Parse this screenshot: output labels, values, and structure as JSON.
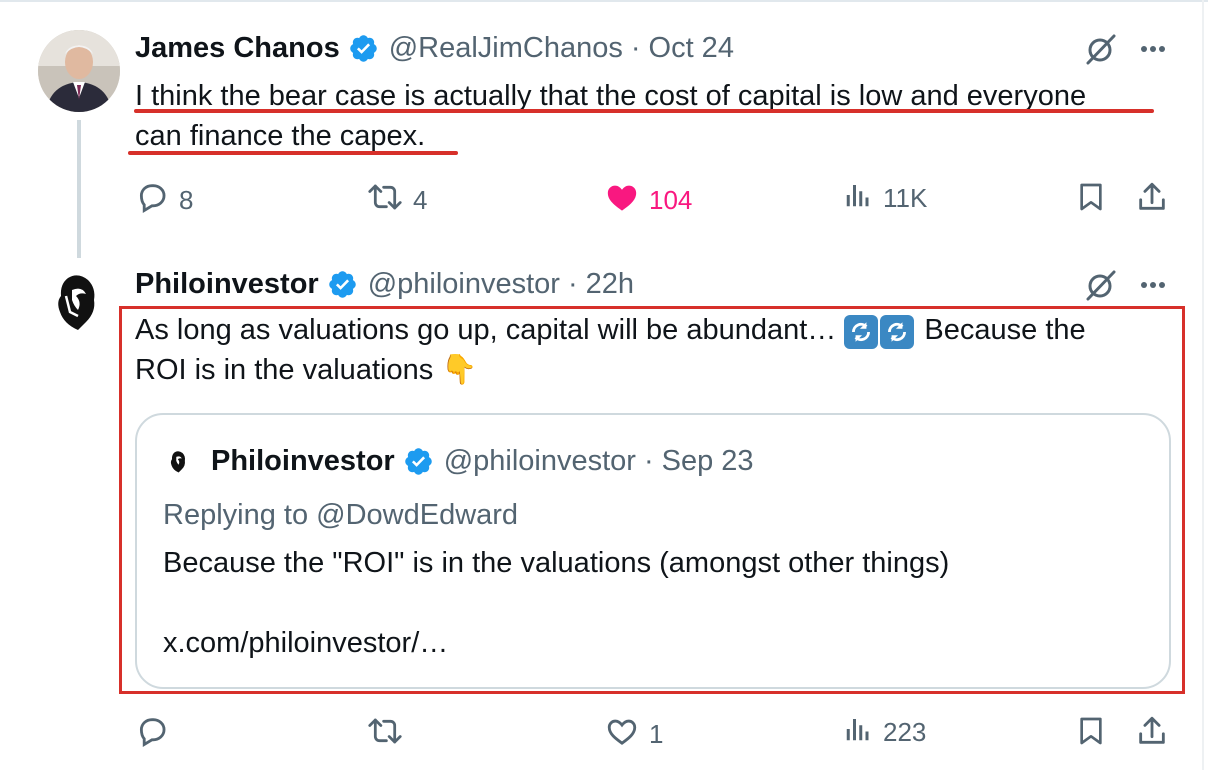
{
  "tweet1": {
    "name": "James Chanos",
    "handle": "@RealJimChanos",
    "separator": "·",
    "time": "Oct 24",
    "text_line1": "I think the bear case is actually that the cost of capital is low and everyone",
    "text_line2": "can finance the capex.",
    "actions": {
      "replies": "8",
      "reposts": "4",
      "likes": "104",
      "views": "11K"
    }
  },
  "tweet2": {
    "name": "Philoinvestor",
    "handle": "@philoinvestor",
    "separator": "·",
    "time": "22h",
    "text_part1": "As long as valuations go up, capital will be abundant…",
    "text_part2": "Because the",
    "text_line2": "ROI is in the valuations",
    "emoji_pointing": "👇",
    "actions": {
      "replies": "",
      "reposts": "",
      "likes": "1",
      "views": "223"
    }
  },
  "quote": {
    "name": "Philoinvestor",
    "handle": "@philoinvestor",
    "separator": "·",
    "time": "Sep 23",
    "replying_to": "Replying to @DowdEdward",
    "text": "Because the \"ROI\" is in the valuations (amongst other things)",
    "link": "x.com/philoinvestor/…"
  },
  "colors": {
    "verified": "#1d9bf0",
    "like_active": "#f91880",
    "muted": "#536471",
    "annotation_red": "#d7302a"
  },
  "icons": [
    "reply-icon",
    "repost-icon",
    "like-icon",
    "views-icon",
    "bookmark-icon",
    "share-icon",
    "grok-icon",
    "more-icon",
    "verified-badge-icon",
    "counterclockwise-arrows-emoji"
  ]
}
